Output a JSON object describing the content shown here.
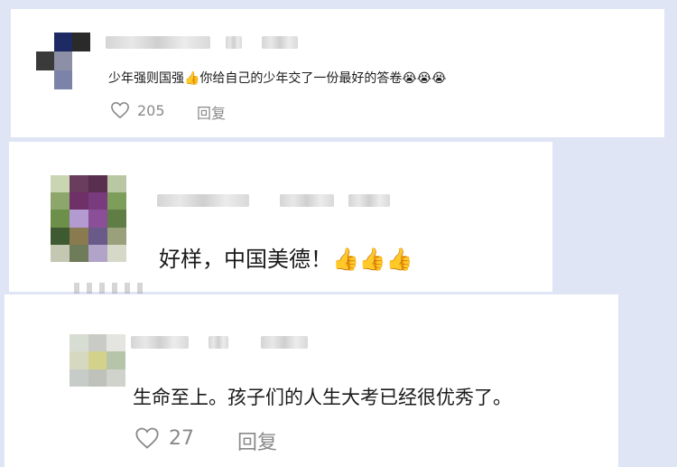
{
  "comments": [
    {
      "text": "少年强则国强👍你给自己的少年交了一份最好的答卷😭😭😭",
      "like_count": "205",
      "reply_label": "回复"
    },
    {
      "text": "好样，中国美德！👍👍👍"
    },
    {
      "text": "生命至上。孩子们的人生大考已经很优秀了。",
      "like_count": "27",
      "reply_label": "回复"
    }
  ],
  "colors": {
    "page_bg": "#dfe5f4",
    "card_bg": "#ffffff",
    "meta_text": "#8a8a8a"
  },
  "icons": [
    "heart-outline-icon",
    "thumbs-up-emoji",
    "crying-emoji"
  ]
}
